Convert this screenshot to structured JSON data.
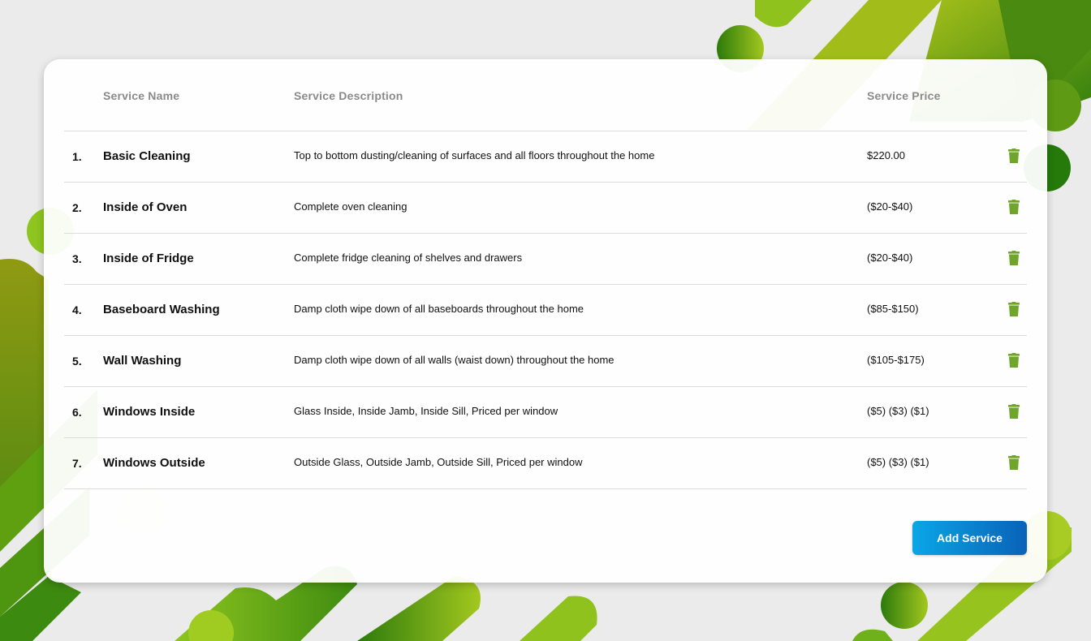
{
  "table": {
    "headers": {
      "name": "Service Name",
      "description": "Service Description",
      "price": "Service Price"
    },
    "rows": [
      {
        "num": "1.",
        "name": "Basic Cleaning",
        "description": "Top to bottom dusting/cleaning of surfaces and all floors throughout the home",
        "price": "$220.00"
      },
      {
        "num": "2.",
        "name": "Inside of Oven",
        "description": "Complete oven cleaning",
        "price": "($20-$40)"
      },
      {
        "num": "3.",
        "name": "Inside of Fridge",
        "description": "Complete fridge cleaning of shelves and drawers",
        "price": "($20-$40)"
      },
      {
        "num": "4.",
        "name": "Baseboard Washing",
        "description": "Damp cloth wipe down of all baseboards throughout the home",
        "price": "($85-$150)"
      },
      {
        "num": "5.",
        "name": "Wall Washing",
        "description": "Damp cloth wipe down of all walls (waist down) throughout the home",
        "price": "($105-$175)"
      },
      {
        "num": "6.",
        "name": "Windows Inside",
        "description": "Glass Inside, Inside Jamb, Inside Sill, Priced per window",
        "price": "($5) ($3) ($1)"
      },
      {
        "num": "7.",
        "name": "Windows Outside",
        "description": "Outside Glass, Outside Jamb, Outside Sill, Priced per window",
        "price": "($5) ($3) ($1)"
      }
    ],
    "row_action_icon": "trash-icon"
  },
  "add_service_label": "Add Service",
  "colors": {
    "trash": "#6fa52a",
    "button_start": "#0aa6e6",
    "button_end": "#0a62b8",
    "background": "#ebebeb",
    "decor_dark_green": "#2f7d0e",
    "decor_light_green": "#9bc51f"
  }
}
